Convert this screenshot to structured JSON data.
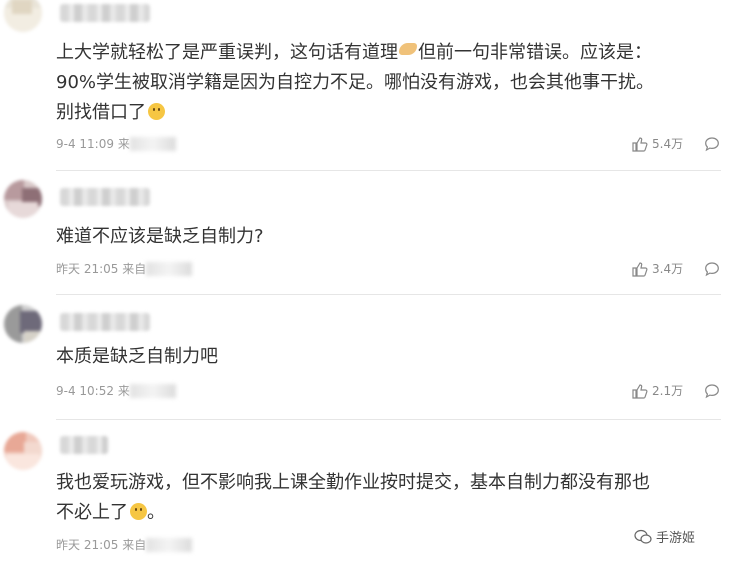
{
  "comments": [
    {
      "text_lines": [
        "上大学就轻松了是严重误判，这句话有道理",
        "但前一句非常错误。应该是：",
        "90%学生被取消学籍是因为自控力不足。哪怕没有游戏，也会其他事干扰。",
        "别找借口了"
      ],
      "time": "9-4 11:09",
      "source_prefix": "来",
      "likes": "5.4万"
    },
    {
      "text_lines": [
        "难道不应该是缺乏自制力?"
      ],
      "time": "昨天 21:05",
      "source_prefix": "来自",
      "likes": "3.4万"
    },
    {
      "text_lines": [
        "本质是缺乏自制力吧"
      ],
      "time": "9-4 10:52",
      "source_prefix": "来",
      "likes": "2.1万"
    },
    {
      "text_lines": [
        "我也爱玩游戏，但不影响我上课全勤作业按时提交，基本自制力都没有那也",
        "不必上了",
        "。"
      ],
      "time": "昨天 21:05",
      "source_prefix": "来自",
      "likes": ""
    }
  ],
  "icons": {
    "like": "thumbs-up-icon",
    "reply": "comment-bubble-icon",
    "emoji": "smiley-emoji-icon",
    "hand": "pointing-hand-emoji-icon"
  },
  "watermark": {
    "text": "手游姬"
  },
  "colors": {
    "text": "#333333",
    "meta": "#999999",
    "divider": "#e6e6e6"
  }
}
